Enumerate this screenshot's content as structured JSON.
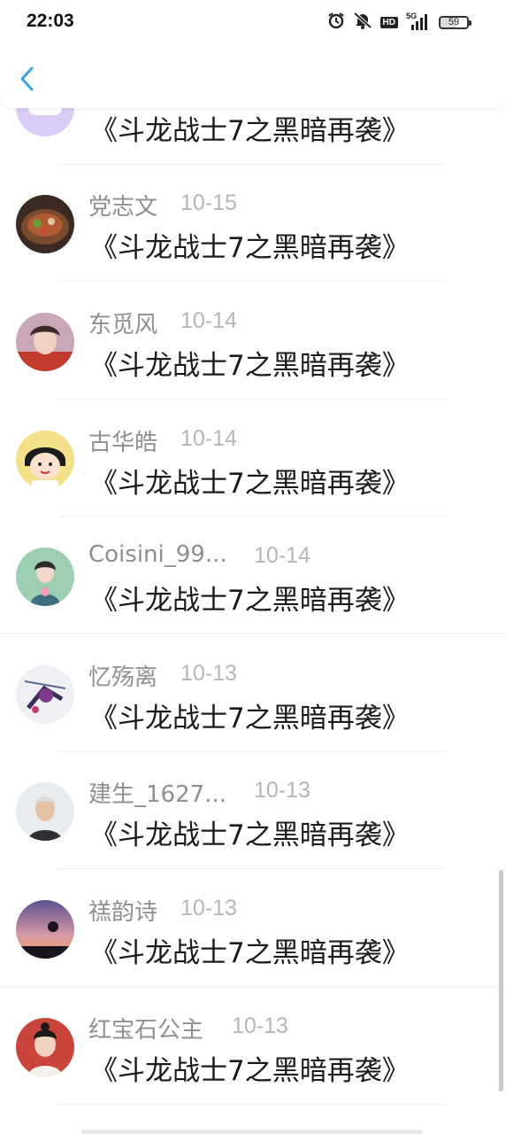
{
  "status_bar": {
    "time": "22:03",
    "icons": [
      "alarm-icon",
      "silent-icon",
      "hd-icon",
      "signal-5g-icon",
      "battery-icon"
    ],
    "hd_label": "HD",
    "network_label": "5G",
    "battery_level": "59"
  },
  "header": {
    "back_icon": "chevron-left-icon",
    "accent_color": "#3ba1e6"
  },
  "comments": [
    {
      "name": "",
      "date": "",
      "text": "《斗龙战士7之黑暗再袭》",
      "avatar": "purple-chat-bubble"
    },
    {
      "name": "党志文",
      "date": "10-15",
      "text": "《斗龙战士7之黑暗再袭》",
      "avatar": "hotpot-food-photo"
    },
    {
      "name": "东觅风",
      "date": "10-14",
      "text": "《斗龙战士7之黑暗再袭》",
      "avatar": "young-man-photo"
    },
    {
      "name": "古华皓",
      "date": "10-14",
      "text": "《斗龙战士7之黑暗再袭》",
      "avatar": "cartoon-girl"
    },
    {
      "name": "Coisini_99...",
      "date": "10-14",
      "text": "《斗龙战士7之黑暗再袭》",
      "avatar": "woman-green-illustration"
    },
    {
      "name": "忆殇离",
      "date": "10-13",
      "text": "《斗龙战士7之黑暗再袭》",
      "avatar": "anime-art"
    },
    {
      "name": "建生_1627...",
      "date": "10-13",
      "text": "《斗龙战士7之黑暗再袭》",
      "avatar": "elderly-man-photo"
    },
    {
      "name": "禚韵诗",
      "date": "10-13",
      "text": "《斗龙战士7之黑暗再袭》",
      "avatar": "sunset-silhouette"
    },
    {
      "name": "红宝石公主",
      "date": "10-13",
      "text": "《斗龙战士7之黑暗再袭》",
      "avatar": "woman-red-photo"
    }
  ]
}
